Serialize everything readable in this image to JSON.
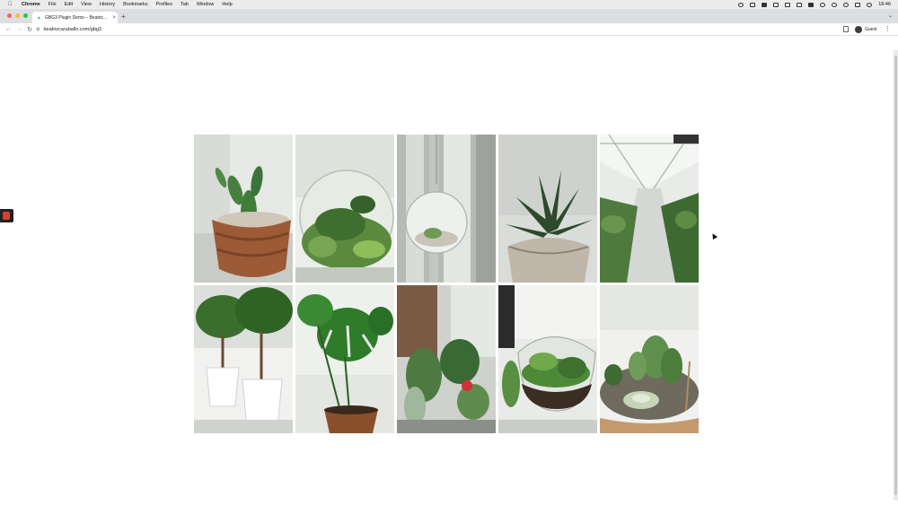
{
  "menubar": {
    "app_name": "Chrome",
    "items": [
      "File",
      "Edit",
      "View",
      "History",
      "Bookmarks",
      "Profiles",
      "Tab",
      "Window",
      "Help"
    ],
    "clock": "18:46"
  },
  "tab": {
    "title": "GBG3 Plugin Demo – Beatric..."
  },
  "address_bar": {
    "url": "beatrizcaraballo.com/gbg3"
  },
  "profile": {
    "label": "Guest"
  },
  "gallery": {
    "images": [
      {
        "name": "cactus-pot"
      },
      {
        "name": "glass-terrarium"
      },
      {
        "name": "hanging-glass-orb"
      },
      {
        "name": "zebra-succulent"
      },
      {
        "name": "greenhouse"
      },
      {
        "name": "bonsai-trees"
      },
      {
        "name": "monstera"
      },
      {
        "name": "cacti-collection"
      },
      {
        "name": "bowl-terrarium"
      },
      {
        "name": "succulent-closeup"
      }
    ]
  }
}
